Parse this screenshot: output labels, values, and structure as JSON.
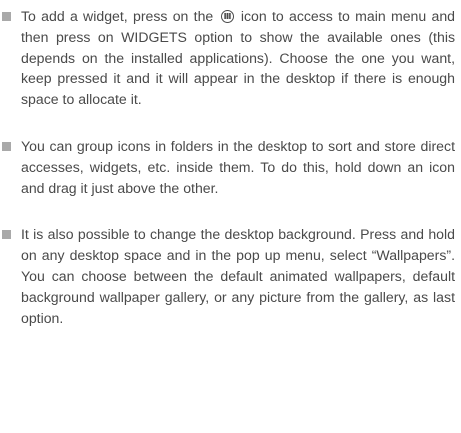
{
  "bullets": [
    {
      "text_before_icon": "To add a widget, press on the",
      "icon": "app-menu-icon",
      "text_after_icon": "icon to access to main menu and then press on WIDGETS option to show the available ones (this depends on the installed applications). Choose the one you want, keep pressed it and it will appear in the desktop if there is enough space to allocate it."
    },
    {
      "text": "You can group icons in folders in the desktop to sort and store direct accesses, widgets, etc. inside them. To do this, hold down an icon and drag it just above the other."
    },
    {
      "text": "It is also possible to change the desktop background. Press and hold on any desktop space and in the pop up menu, select “Wallpapers”. You can choose between the default animated wallpapers, default background wallpaper gallery, or any picture from the gallery, as last option."
    }
  ],
  "colors": {
    "text": "#4a4a4a",
    "bullet": "#a9a9a9"
  }
}
